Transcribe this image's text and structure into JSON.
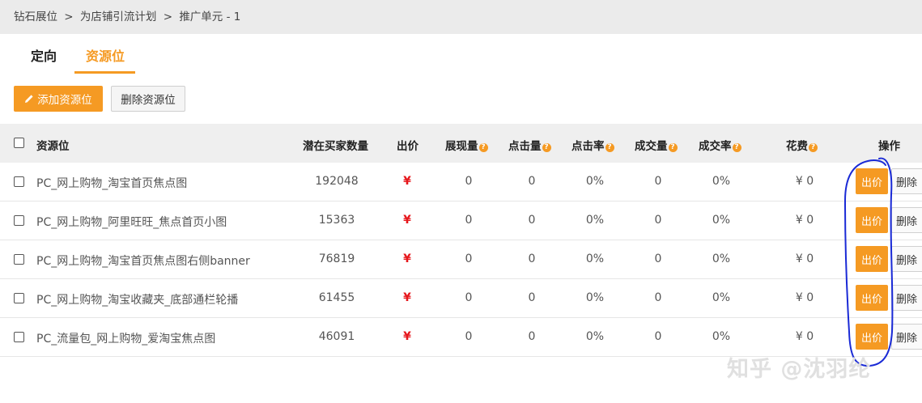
{
  "breadcrumb": {
    "items": [
      "钻石展位",
      "为店铺引流计划",
      "推广单元 - 1"
    ],
    "separator": ">"
  },
  "tabs": [
    {
      "label": "定向",
      "active": false
    },
    {
      "label": "资源位",
      "active": true
    }
  ],
  "toolbar": {
    "add_label": "添加资源位",
    "delete_label": "删除资源位"
  },
  "table": {
    "headers": {
      "resource": "资源位",
      "buyers": "潜在买家数量",
      "bid": "出价",
      "impressions": "展现量",
      "clicks": "点击量",
      "ctr": "点击率",
      "deals": "成交量",
      "conversion": "成交率",
      "cost": "花费",
      "actions": "操作"
    },
    "help_glyph": "?",
    "rows": [
      {
        "name": "PC_网上购物_淘宝首页焦点图",
        "buyers": "192048",
        "bid": "¥",
        "impressions": "0",
        "clicks": "0",
        "ctr": "0%",
        "deals": "0",
        "conversion": "0%",
        "cost": "¥ 0"
      },
      {
        "name": "PC_网上购物_阿里旺旺_焦点首页小图",
        "buyers": "15363",
        "bid": "¥",
        "impressions": "0",
        "clicks": "0",
        "ctr": "0%",
        "deals": "0",
        "conversion": "0%",
        "cost": "¥ 0"
      },
      {
        "name": "PC_网上购物_淘宝首页焦点图右侧banner",
        "buyers": "76819",
        "bid": "¥",
        "impressions": "0",
        "clicks": "0",
        "ctr": "0%",
        "deals": "0",
        "conversion": "0%",
        "cost": "¥ 0"
      },
      {
        "name": "PC_网上购物_淘宝收藏夹_底部通栏轮播",
        "buyers": "61455",
        "bid": "¥",
        "impressions": "0",
        "clicks": "0",
        "ctr": "0%",
        "deals": "0",
        "conversion": "0%",
        "cost": "¥ 0"
      },
      {
        "name": "PC_流量包_网上购物_爱淘宝焦点图",
        "buyers": "46091",
        "bid": "¥",
        "impressions": "0",
        "clicks": "0",
        "ctr": "0%",
        "deals": "0",
        "conversion": "0%",
        "cost": "¥ 0"
      }
    ],
    "row_actions": {
      "bid_label": "出价",
      "delete_label": "删除"
    }
  },
  "watermark": "知乎 @沈羽纶",
  "colors": {
    "accent": "#f59a23",
    "yen_red": "#e6171c",
    "annotation_blue": "#1a2ad6"
  }
}
